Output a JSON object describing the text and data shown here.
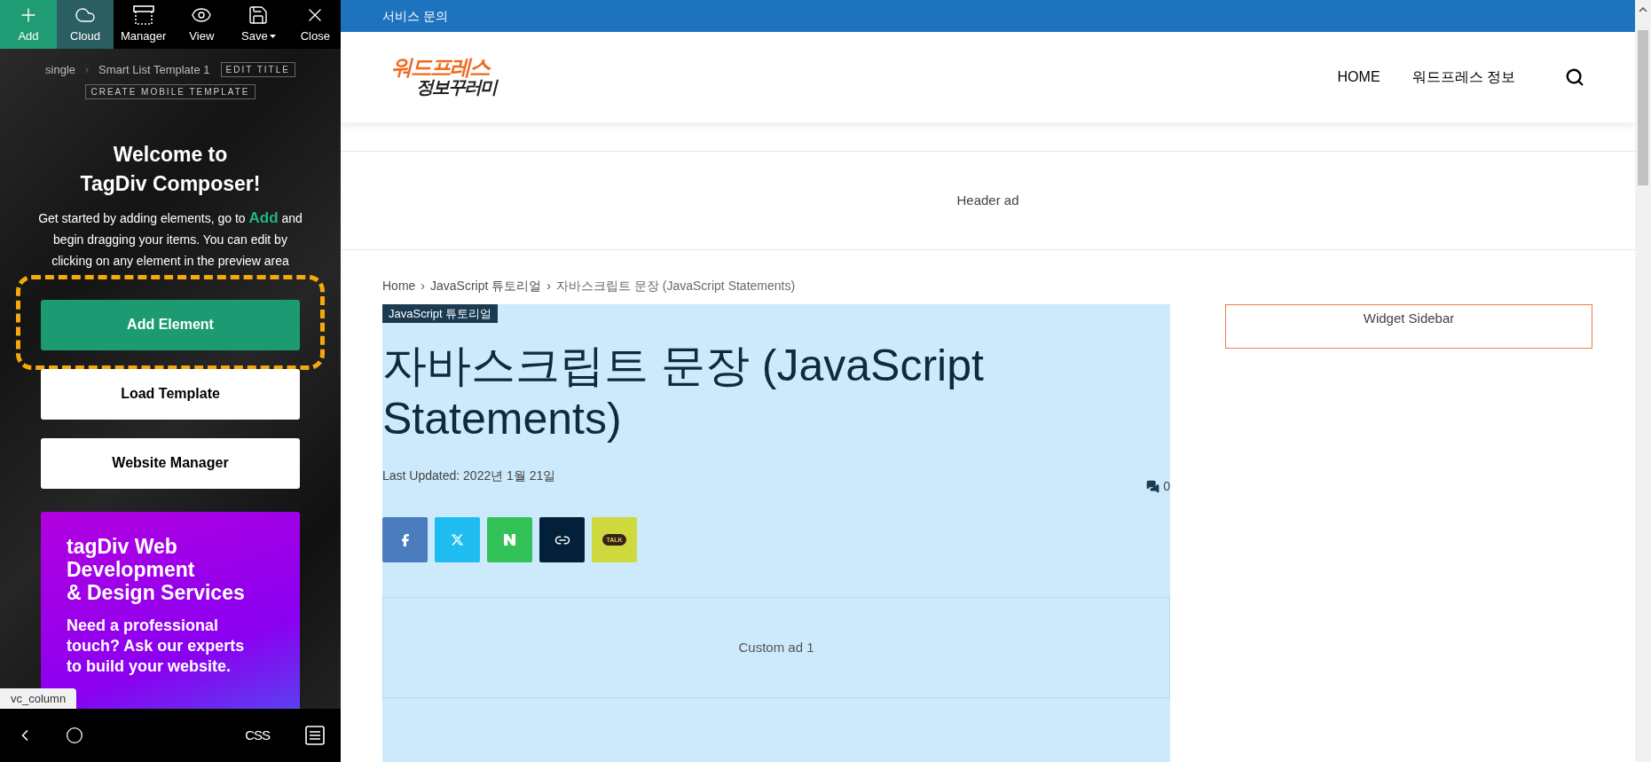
{
  "toolbar": {
    "items": [
      {
        "label": "Add",
        "kind": "add",
        "selected": true,
        "hovered": false
      },
      {
        "label": "Cloud",
        "kind": "cloud",
        "selected": false,
        "hovered": true
      },
      {
        "label": "Manager",
        "kind": "manager",
        "selected": false,
        "hovered": false
      },
      {
        "label": "View",
        "kind": "view",
        "selected": false,
        "hovered": false
      },
      {
        "label": "Save",
        "kind": "save",
        "selected": false,
        "hovered": false
      },
      {
        "label": "Close",
        "kind": "close",
        "selected": false,
        "hovered": false
      }
    ]
  },
  "panel": {
    "breadcrumb": [
      "single",
      "Smart List Template 1"
    ],
    "edit_title": "EDIT TITLE",
    "create_mobile": "CREATE MOBILE TEMPLATE",
    "welcome": [
      "Welcome to",
      "TagDiv Composer!"
    ],
    "intro_before": "Get started by adding elements, go to",
    "intro_link": "Add",
    "intro_after": "and begin dragging your items. You can edit by clicking on any element in the preview area",
    "buttons": [
      {
        "label": "Add Element",
        "kind": "primary",
        "highlighted": true
      },
      {
        "label": "Load Template",
        "kind": "secondary",
        "highlighted": false
      },
      {
        "label": "Website Manager",
        "kind": "secondary",
        "highlighted": false
      }
    ],
    "promo": {
      "headline": [
        "tagDiv Web",
        "Development",
        "& Design Services"
      ],
      "body": [
        "Need a professional",
        "touch? Ask our experts",
        "to build your website."
      ]
    },
    "element_tag": "vc_column",
    "bottom_bar": {
      "css": "CSS"
    }
  },
  "site": {
    "top_bar": "서비스 문의",
    "logo": [
      "워드프레스",
      "정보꾸러미"
    ],
    "menu": [
      "HOME",
      "워드프레스 정보"
    ],
    "header_ad": "Header ad",
    "breadcrumb": [
      {
        "text": "Home",
        "kind": "link"
      },
      {
        "text": "›",
        "kind": "separator"
      },
      {
        "text": "JavaScript 튜토리얼",
        "kind": "link"
      },
      {
        "text": "›",
        "kind": "separator"
      },
      {
        "text": "자바스크립트 문장 (JavaScript Statements)",
        "kind": "current"
      }
    ],
    "category": "JavaScript 튜토리얼",
    "title": "자바스크립트 문장 (JavaScript Statements)",
    "updated": "Last Updated: 2022년 1월 21일",
    "comments": "0",
    "share": [
      {
        "kind": "facebook",
        "color": "#4a7cbe"
      },
      {
        "kind": "x",
        "color": "#1fbcf2"
      },
      {
        "kind": "naver",
        "color": "#33c258"
      },
      {
        "kind": "link",
        "color": "#03203a"
      },
      {
        "kind": "kakao",
        "color": "#cdd93d",
        "text": "TALK"
      }
    ],
    "custom_ad": "Custom ad 1",
    "sidebar_widget": "Widget Sidebar"
  }
}
